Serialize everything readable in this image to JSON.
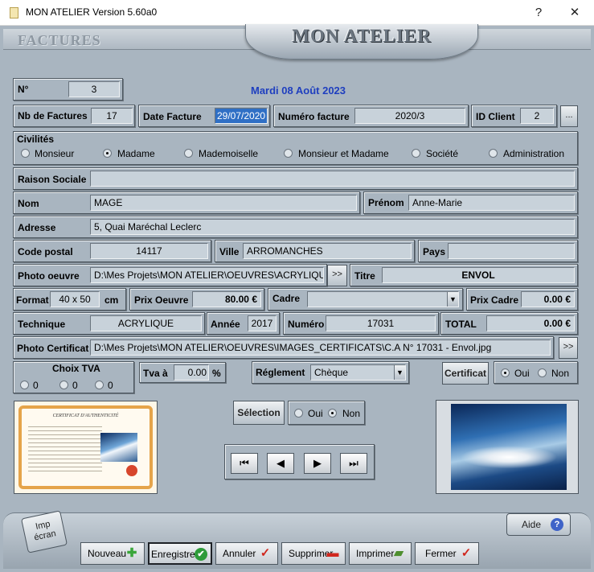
{
  "window": {
    "title": "MON ATELIER  Version 5.60a0",
    "help_glyph": "?",
    "close_glyph": "✕"
  },
  "header": {
    "section": "FACTURES",
    "logo": "MON ATELIER"
  },
  "form": {
    "n_label": "N°",
    "n_value": "3",
    "date_display": "Mardi 08 Août 2023",
    "nb_factures_label": "Nb de Factures",
    "nb_factures_value": "17",
    "date_facture_label": "Date Facture",
    "date_facture_value": "29/07/2020",
    "numero_facture_label": "Numéro facture",
    "numero_facture_value": "2020/3",
    "id_client_label": "ID Client",
    "id_client_value": "2",
    "id_client_button": "...",
    "civilites_label": "Civilités",
    "civilites": [
      "Monsieur",
      "Madame",
      "Mademoiselle",
      "Monsieur et Madame",
      "Société",
      "Administration"
    ],
    "civilite_selected": "Madame",
    "raison_sociale_label": "Raison Sociale",
    "raison_sociale_value": "",
    "nom_label": "Nom",
    "nom_value": "MAGE",
    "prenom_label": "Prénom",
    "prenom_value": "Anne-Marie",
    "adresse_label": "Adresse",
    "adresse_value": "5, Quai Maréchal Leclerc",
    "code_postal_label": "Code postal",
    "code_postal_value": "14117",
    "ville_label": "Ville",
    "ville_value": "ARROMANCHES",
    "pays_label": "Pays",
    "pays_value": "",
    "photo_oeuvre_label": "Photo oeuvre",
    "photo_oeuvre_value": "D:\\Mes Projets\\MON ATELIER\\OEUVRES\\ACRYLIQUE\\E",
    "browse_button": ">>",
    "titre_label": "Titre",
    "titre_value": "ENVOL",
    "format_label": "Format",
    "format_value": "40 x 50",
    "format_unit": "cm",
    "prix_oeuvre_label": "Prix Oeuvre",
    "prix_oeuvre_value": "80.00 €",
    "cadre_label": "Cadre",
    "cadre_value": "",
    "prix_cadre_label": "Prix Cadre",
    "prix_cadre_value": "0.00 €",
    "technique_label": "Technique",
    "technique_value": "ACRYLIQUE",
    "annee_label": "Année",
    "annee_value": "2017",
    "numero_label": "Numéro",
    "numero_value": "17031",
    "total_label": "TOTAL",
    "total_value": "0.00 €",
    "photo_certificat_label": "Photo Certificat",
    "photo_certificat_value": "D:\\Mes Projets\\MON ATELIER\\OEUVRES\\IMAGES_CERTIFICATS\\C.A N° 17031 - Envol.jpg",
    "choix_tva_label": "Choix TVA",
    "tva_options": [
      "0",
      "0",
      "0"
    ],
    "tva_a_label": "Tva à",
    "tva_a_value": "0.00",
    "tva_unit": "%",
    "reglement_label": "Réglement",
    "reglement_value": "Chèque",
    "certificat_label": "Certificat",
    "certificat_options": [
      "Oui",
      "Non"
    ],
    "certificat_selected": "Oui",
    "selection_label": "Sélection",
    "selection_options": [
      "Oui",
      "Non"
    ],
    "selection_selected": "Non"
  },
  "certificate_thumb": {
    "heading": "CERTIFICAT D'AUTHENTICITÉ"
  },
  "nav": {
    "first": "⏮",
    "prev": "◀",
    "next": "▶",
    "last": "⏭"
  },
  "toolbar": {
    "imp_ecran": "Imp écran",
    "aide": "Aide",
    "nouveau": "Nouveau",
    "enregistrer": "Enregistrer",
    "annuler": "Annuler",
    "supprimer": "Supprimer",
    "imprimer": "Imprimer",
    "fermer": "Fermer"
  },
  "colors": {
    "surface": "#a9b5c0",
    "date_blue": "#1f3fbf",
    "selected_field": "#2f6fc5"
  }
}
